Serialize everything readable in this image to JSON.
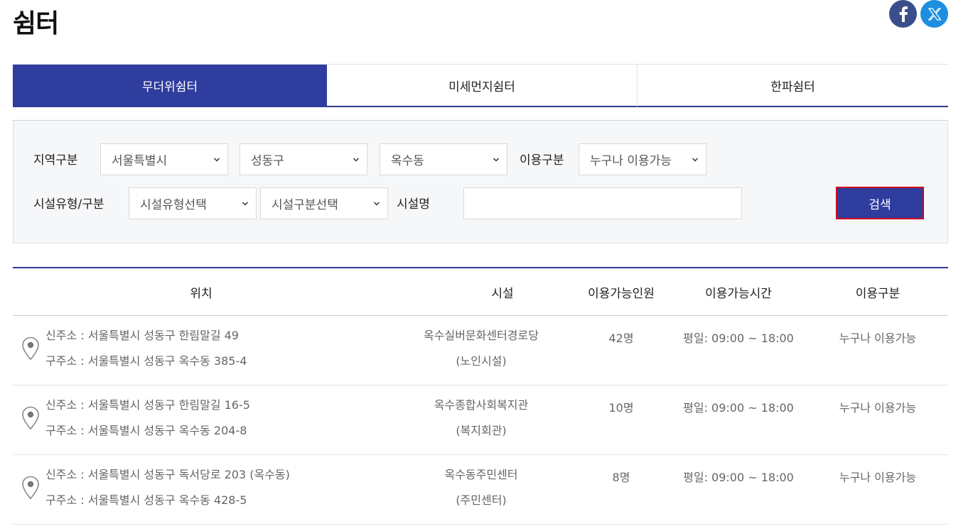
{
  "page": {
    "title": "쉼터"
  },
  "share": {
    "facebook_icon": "facebook-icon",
    "x_icon": "x-twitter-icon",
    "facebook_color": "#3b4e8c",
    "x_color": "#1d8fe0"
  },
  "tabs": [
    {
      "label": "무더위쉼터",
      "active": true
    },
    {
      "label": "미세먼지쉼터",
      "active": false
    },
    {
      "label": "한파쉼터",
      "active": false
    }
  ],
  "search": {
    "region_label": "지역구분",
    "city_value": "서울특별시",
    "district_value": "성동구",
    "dong_value": "옥수동",
    "usage_label": "이용구분",
    "usage_value": "누구나 이용가능",
    "facility_type_label": "시설유형/구분",
    "facility_type_value": "시설유형선택",
    "facility_class_value": "시설구분선택",
    "facility_name_label": "시설명",
    "facility_name_value": "",
    "search_button": "검색"
  },
  "table": {
    "headers": {
      "location": "위치",
      "facility": "시설",
      "capacity": "이용가능인원",
      "hours": "이용가능시간",
      "usage": "이용구분"
    },
    "rows": [
      {
        "new_addr": "신주소 : 서울특별시 성동구 한림말길 49",
        "old_addr": "구주소 : 서울특별시 성동구 옥수동 385-4",
        "facility_name": "옥수실버문화센터경로당",
        "facility_type": "(노인시설)",
        "capacity": "42명",
        "hours": "평일: 09:00 ~ 18:00",
        "usage": "누구나 이용가능"
      },
      {
        "new_addr": "신주소 : 서울특별시 성동구 한림말길 16-5",
        "old_addr": "구주소 : 서울특별시 성동구 옥수동 204-8",
        "facility_name": "옥수종합사회복지관",
        "facility_type": "(복지회관)",
        "capacity": "10명",
        "hours": "평일: 09:00 ~ 18:00",
        "usage": "누구나 이용가능"
      },
      {
        "new_addr": "신주소 : 서울특별시 성동구 독서당로 203 (옥수동)",
        "old_addr": "구주소 : 서울특별시 성동구 옥수동 428-5",
        "facility_name": "옥수동주민센터",
        "facility_type": "(주민센터)",
        "capacity": "8명",
        "hours": "평일: 09:00 ~ 18:00",
        "usage": "누구나 이용가능"
      }
    ]
  }
}
